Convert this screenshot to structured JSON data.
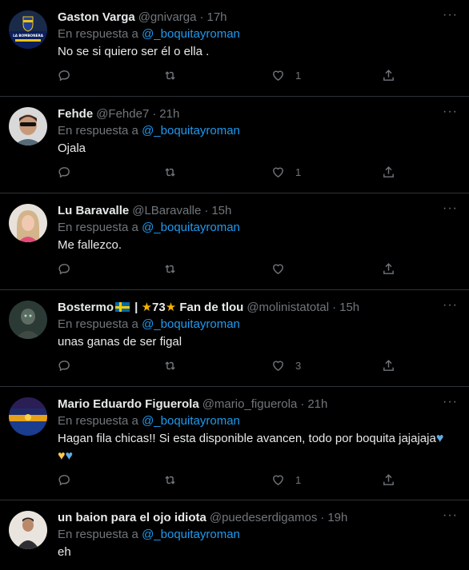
{
  "reply_prefix": "En respuesta a",
  "tweets": [
    {
      "name": "Gaston Varga",
      "handle": "@gnivarga",
      "time": "17h",
      "mention": "@_boquitayroman",
      "text": "No se si quiero ser él o ella .",
      "likes": "1",
      "avatar_text": "LA BOMBONERA"
    },
    {
      "name": "Fehde",
      "handle": "@Fehde7",
      "time": "21h",
      "mention": "@_boquitayroman",
      "text": "Ojala",
      "likes": "1"
    },
    {
      "name": "Lu Baravalle",
      "handle": "@LBaravalle",
      "time": "15h",
      "mention": "@_boquitayroman",
      "text": "Me fallezco.",
      "likes": ""
    },
    {
      "name_prefix": "Bostermo",
      "name_sep": " | ",
      "name_star_num": "73",
      "name_suffix": " Fan de tlou",
      "handle": "@molinistatotal",
      "time": "15h",
      "mention": "@_boquitayroman",
      "text": "unas ganas de ser figal",
      "likes": "3"
    },
    {
      "name": "Mario Eduardo Figuerola",
      "handle": "@mario_figuerola",
      "time": "21h",
      "mention": "@_boquitayroman",
      "text": "Hagan fila chicas!! Si esta disponible avancen,  todo por boquita jajajaja",
      "likes": "1"
    },
    {
      "name": "un baion para el ojo idiota",
      "handle": "@puedeserdigamos",
      "time": "19h",
      "mention": "@_boquitayroman",
      "text": "eh",
      "likes": ""
    }
  ],
  "icons": [
    "reply-icon",
    "retweet-icon",
    "like-icon",
    "share-icon",
    "more-icon"
  ],
  "colors": {
    "background": "#000000",
    "accent": "#1d9bf0",
    "muted": "#71767b",
    "text": "#e7e9ea",
    "divider": "#2f3336"
  }
}
